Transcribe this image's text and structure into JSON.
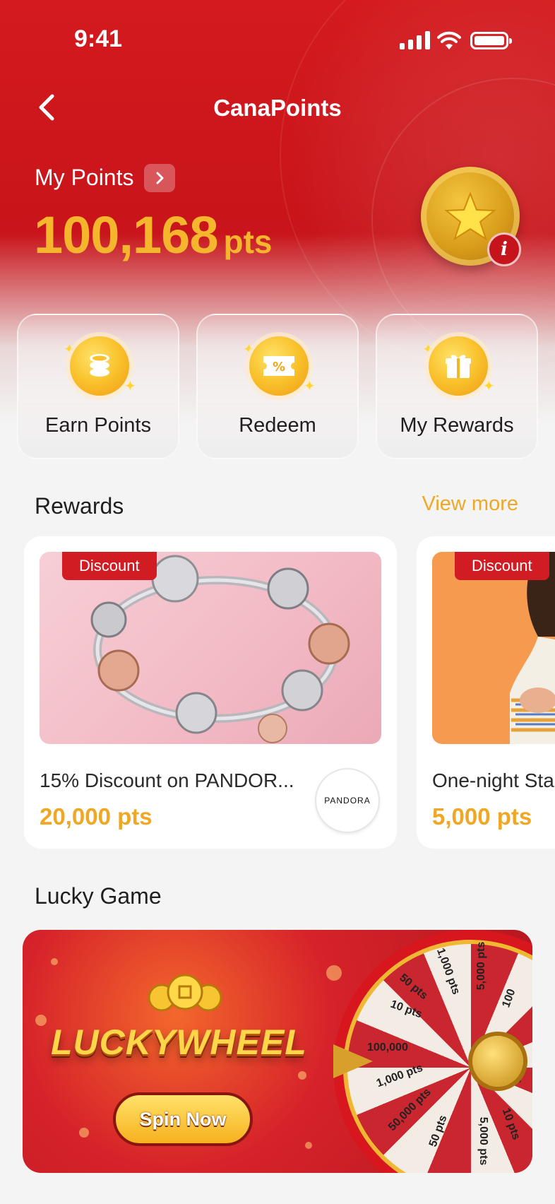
{
  "status_bar": {
    "time": "9:41"
  },
  "header": {
    "title": "CanaPoints"
  },
  "points": {
    "label": "My Points",
    "value": "100,168",
    "unit": "pts"
  },
  "quick_actions": [
    {
      "label": "Earn Points",
      "icon": "coins-stack-icon"
    },
    {
      "label": "Redeem",
      "icon": "voucher-percent-icon"
    },
    {
      "label": "My Rewards",
      "icon": "gift-icon"
    }
  ],
  "rewards": {
    "title": "Rewards",
    "view_more": "View more",
    "items": [
      {
        "tag": "Discount",
        "name": "15% Discount on PANDOR...",
        "points": "20,000 pts",
        "brand": "PANDORA"
      },
      {
        "tag": "Discount",
        "name": "One-night Sta",
        "points": "5,000 pts"
      }
    ]
  },
  "lucky_game": {
    "title": "Lucky Game",
    "banner_title": "LUCKYWHEEL",
    "button": "Spin Now",
    "wheel_labels": [
      "100,000",
      "1,000 pts",
      "50,000 pts",
      "50 pts",
      "5,000 pts",
      "10 pts",
      "10 pts",
      "50 pts",
      "100",
      "5,000 pts",
      "1,000 pts",
      "100"
    ]
  },
  "colors": {
    "primary_red": "#d41a1e",
    "accent_gold": "#efa825",
    "background": "#f4f4f4"
  }
}
